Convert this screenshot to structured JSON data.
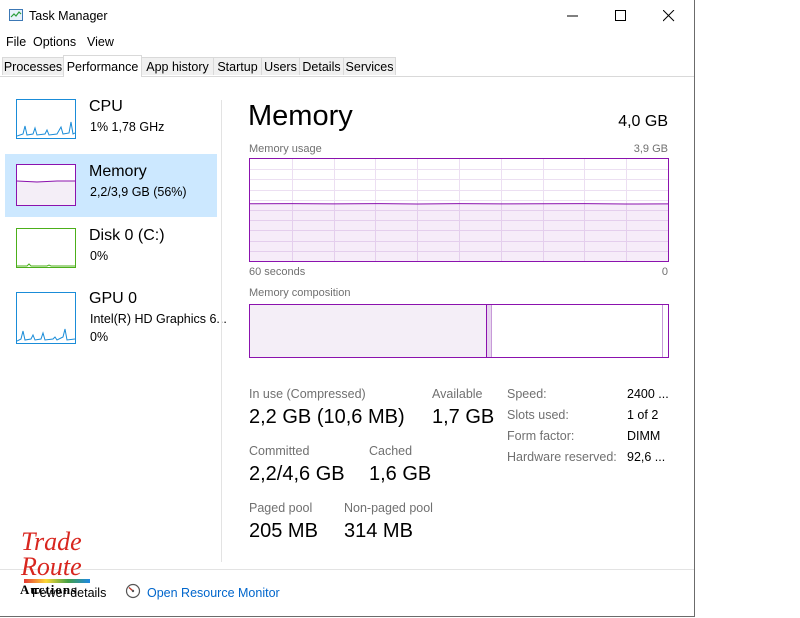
{
  "window": {
    "title": "Task Manager"
  },
  "menu": {
    "file": "File",
    "options": "Options",
    "view": "View"
  },
  "tabs": [
    "Processes",
    "Performance",
    "App history",
    "Startup",
    "Users",
    "Details",
    "Services"
  ],
  "sidebar": {
    "cpu": {
      "name": "CPU",
      "detail": "1%  1,78 GHz"
    },
    "memory": {
      "name": "Memory",
      "detail": "2,2/3,9 GB (56%)"
    },
    "disk": {
      "name": "Disk 0 (C:)",
      "detail": "0%"
    },
    "gpu": {
      "name": "GPU 0",
      "detail1": "Intel(R) HD Graphics 6...",
      "detail2": "0%"
    }
  },
  "main": {
    "title": "Memory",
    "total": "4,0 GB",
    "usage_label": "Memory usage",
    "usage_max": "3,9 GB",
    "axis_left": "60 seconds",
    "axis_right": "0",
    "composition_label": "Memory composition",
    "usage_fraction": 0.56
  },
  "stats": {
    "in_use_label": "In use (Compressed)",
    "in_use_value": "2,2 GB (10,6 MB)",
    "available_label": "Available",
    "available_value": "1,7 GB",
    "committed_label": "Committed",
    "committed_value": "2,2/4,6 GB",
    "cached_label": "Cached",
    "cached_value": "1,6 GB",
    "paged_label": "Paged pool",
    "paged_value": "205 MB",
    "nonpaged_label": "Non-paged pool",
    "nonpaged_value": "314 MB"
  },
  "info": {
    "speed_label": "Speed:",
    "speed_value": "2400 ...",
    "slots_label": "Slots used:",
    "slots_value": "1 of 2",
    "form_label": "Form factor:",
    "form_value": "DIMM",
    "hw_label": "Hardware reserved:",
    "hw_value": "92,6 ..."
  },
  "footer": {
    "fewer_details": "Fewer details",
    "resource_monitor": "Open Resource Monitor"
  },
  "watermark": {
    "line1": "Trade",
    "line2": "Route",
    "line3": "Auctions"
  },
  "colors": {
    "memory": "#8b12ae",
    "cpu": "#1a8cd8",
    "disk": "#4caf1a",
    "selected": "#cce8ff",
    "link": "#0066cc"
  }
}
